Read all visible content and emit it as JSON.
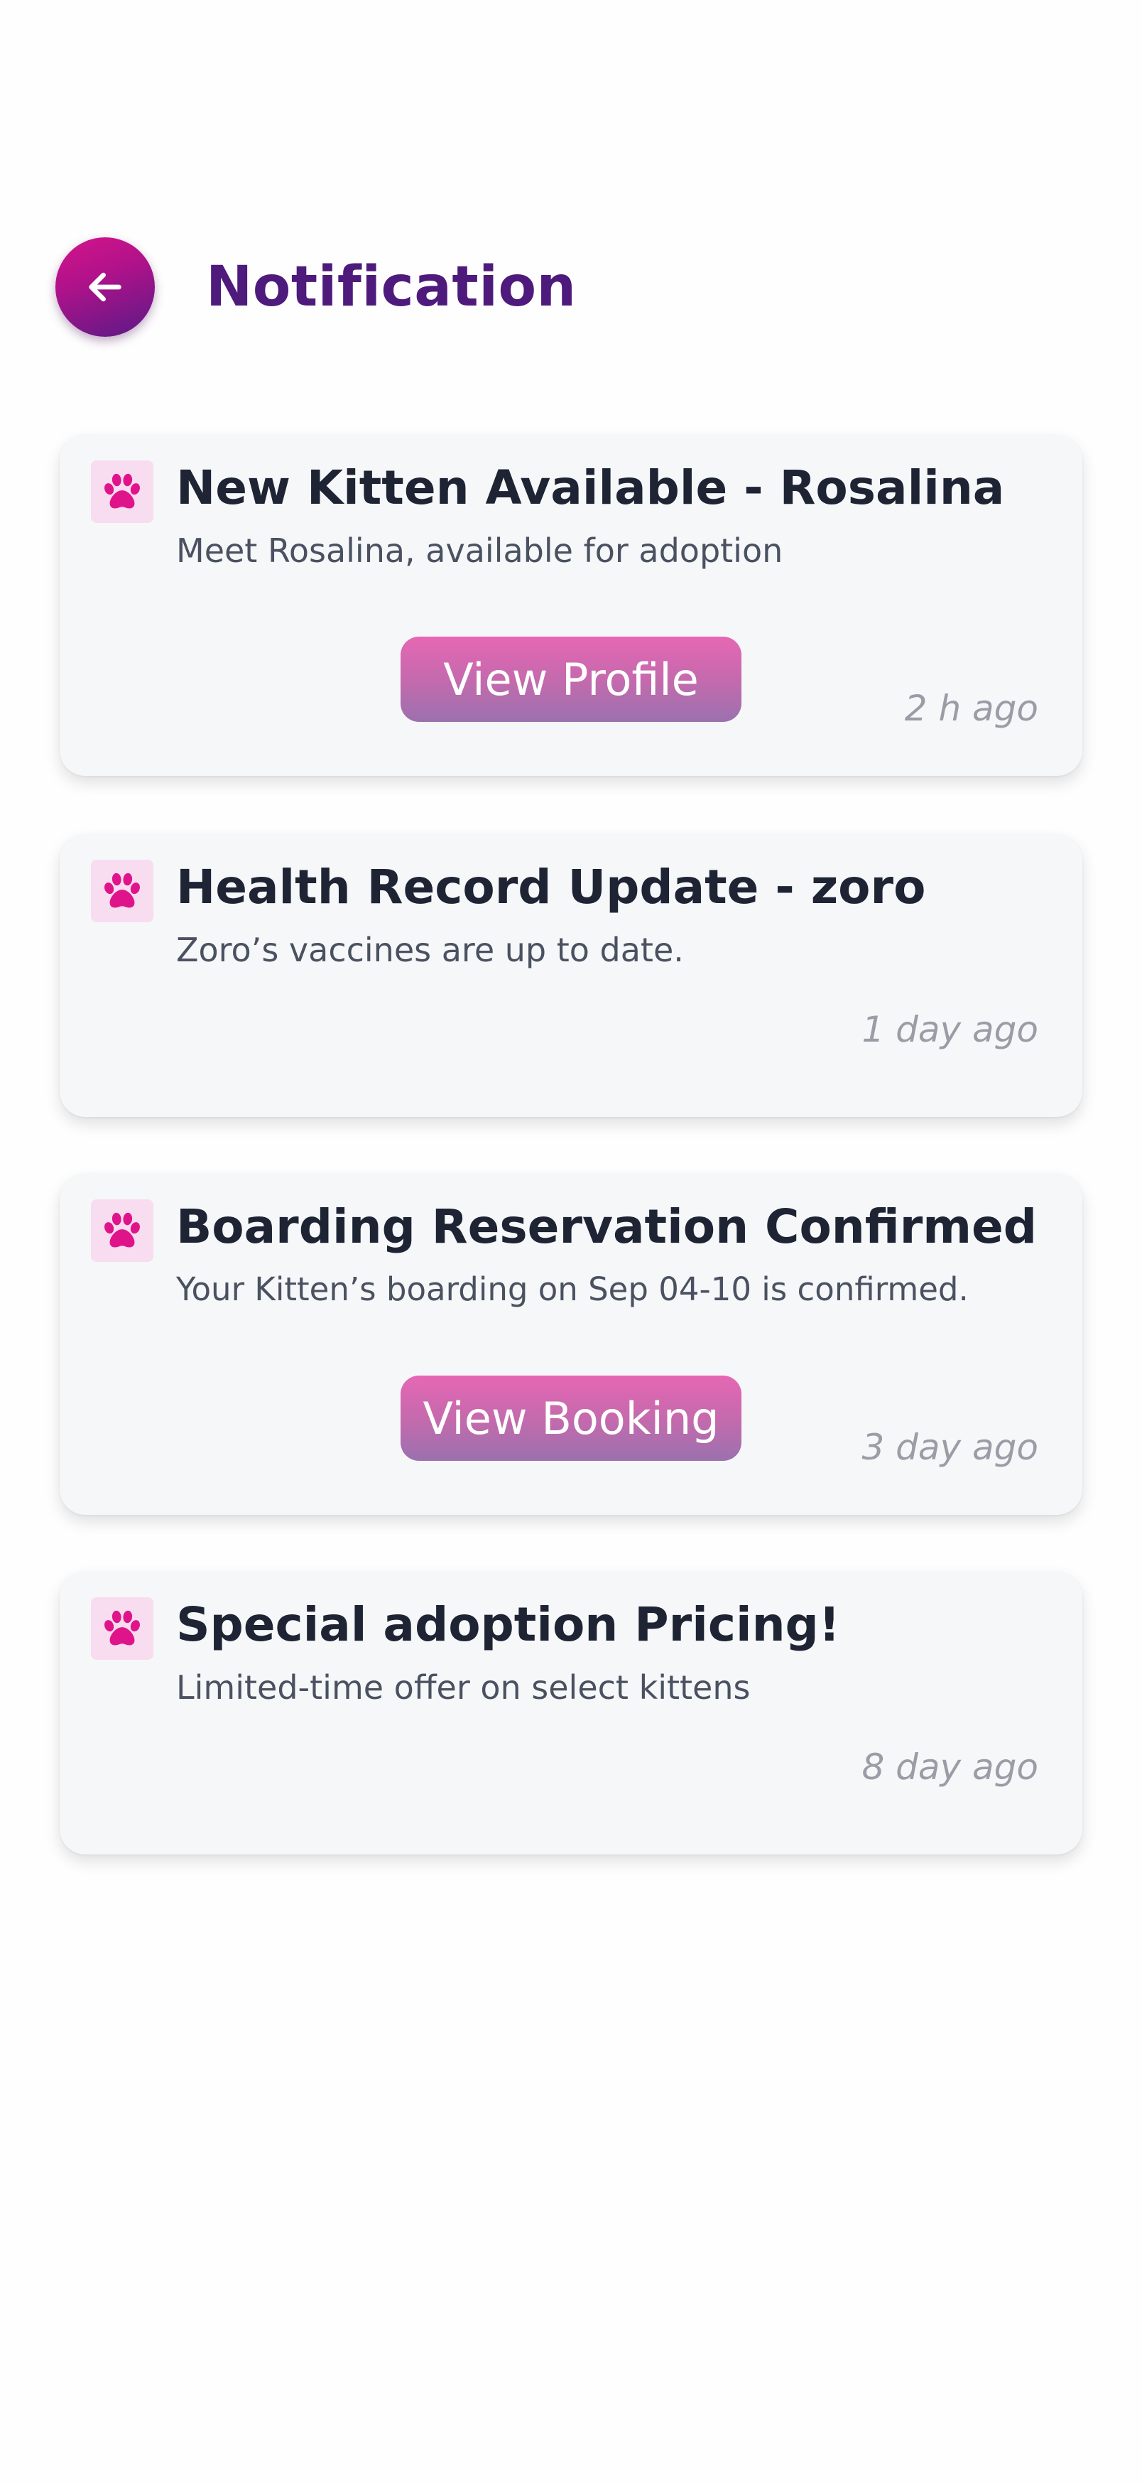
{
  "header": {
    "title": "Notification",
    "back_icon": "arrow-left-icon"
  },
  "colors": {
    "title": "#4e1a7c",
    "back_gradient": [
      "#d4148a",
      "#5a1a86"
    ],
    "paw": "#e0148a",
    "button_gradient": [
      "#e667b4",
      "#9b71ae"
    ]
  },
  "notifications": [
    {
      "icon": "paw-icon",
      "title": "New Kitten Available - Rosalina",
      "message": "Meet Rosalina, available for adoption",
      "action_label": "View Profile",
      "time": "2 h ago"
    },
    {
      "icon": "paw-icon",
      "title": "Health Record Update - zoro",
      "message": "Zoro’s vaccines are up to date.",
      "time": "1 day ago"
    },
    {
      "icon": "paw-icon",
      "title": "Boarding Reservation Confirmed",
      "message": "Your Kitten’s boarding on Sep 04-10 is confirmed.",
      "action_label": "View Booking",
      "time": "3 day ago"
    },
    {
      "icon": "paw-icon",
      "title": "Special adoption Pricing!",
      "message": "Limited-time offer on select kittens",
      "time": "8 day ago"
    }
  ]
}
